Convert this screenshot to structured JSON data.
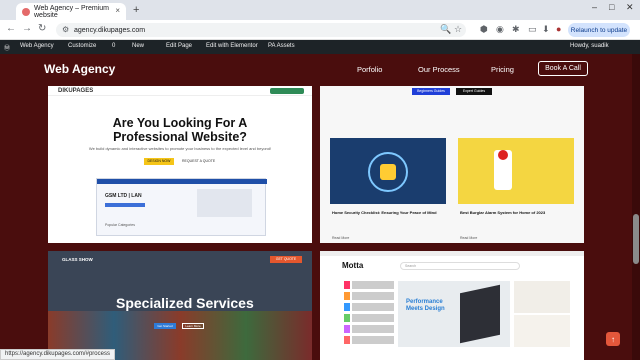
{
  "browser": {
    "tab_title": "Web Agency – Premium website",
    "url": "agency.dikupages.com",
    "relaunch_label": "Relaunch to update",
    "new_tab_symbol": "+",
    "close_symbol": "×"
  },
  "admin_bar": {
    "items": [
      "Web Agency",
      "Customize",
      "0",
      "New",
      "Edit Page",
      "Edit with Elementor",
      "PA Assets"
    ],
    "greeting": "Howdy, suadik"
  },
  "site": {
    "logo": "Web Agency",
    "nav": [
      "Porfolio",
      "Our Process",
      "Pricing"
    ],
    "cta": "Book A Call",
    "accent": "#4a0d0d"
  },
  "cards": {
    "c1": {
      "brand": "DIKUPAGES",
      "headline": "Are You Looking For A Professional Website?",
      "sub": "We build dynamic and interactive websites to promote your business to the expected level and beyond!",
      "btn1": "DESIGN NOW",
      "btn2": "REQUEST A QUOTE",
      "mock_title": "GSM LTD | LAN",
      "cat_label": "Popular Categories"
    },
    "c2": {
      "tab1": "Beginners Guides",
      "tab2": "Expert Guides",
      "post1": "Home Security Checklist: Ensuring Your Peace of Mind",
      "post2": "Best Burglar Alarm System for Home of 2023",
      "read_more": "Read More"
    },
    "c3": {
      "brand": "GLASS SHOW",
      "cta": "GET QUOTE",
      "headline": "Specialized Services",
      "btn1": "Get Started",
      "btn2": "Learn More"
    },
    "c4": {
      "brand": "Motta",
      "banner": "Performance Meets Design",
      "search": "Search"
    }
  },
  "status_url": "https://agency.dikupages.com/#process",
  "back_to_top": "↑"
}
